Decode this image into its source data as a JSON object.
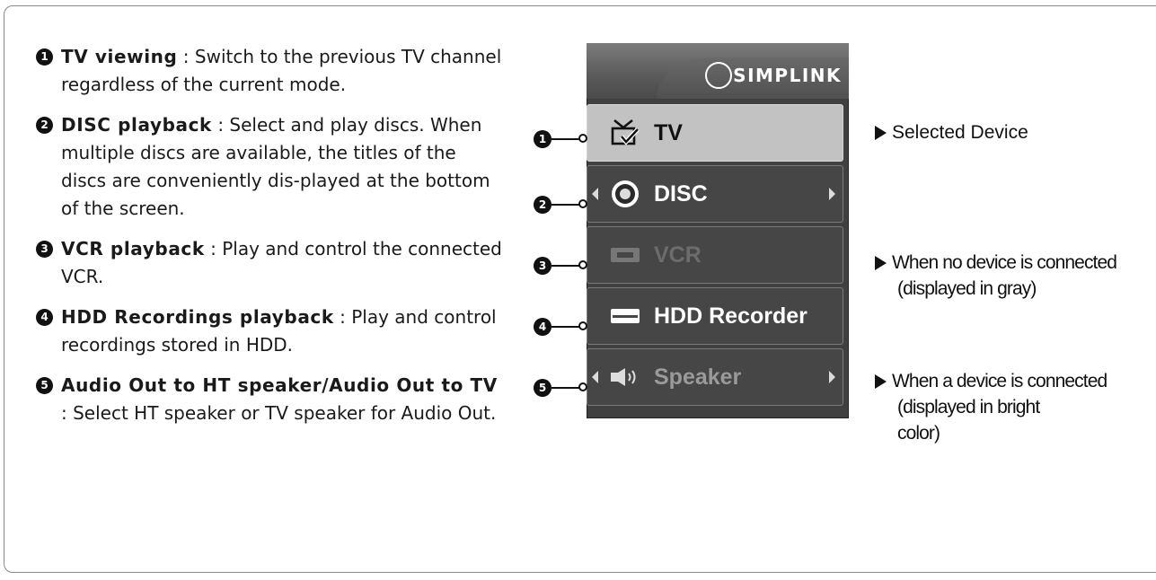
{
  "features": [
    {
      "num": "1",
      "title": "TV viewing",
      "desc": ": Switch to the previous TV channel regardless of the current mode."
    },
    {
      "num": "2",
      "title": "DISC playback",
      "desc": ": Select and play discs. When multiple discs are available, the titles of the discs are conveniently dis-played at the bottom of the screen."
    },
    {
      "num": "3",
      "title": "VCR playback",
      "desc": ": Play and control the connected VCR."
    },
    {
      "num": "4",
      "title": "HDD Recordings playback",
      "desc": ": Play and control recordings stored in HDD."
    },
    {
      "num": "5",
      "title": "Audio Out to HT speaker/Audio Out to TV",
      "desc": ": Select HT speaker or TV speaker for Audio Out."
    }
  ],
  "menu": {
    "logo": "SIMPLINK",
    "items": [
      {
        "label": "TV",
        "icon": "tv-check-icon",
        "state": "selected"
      },
      {
        "label": "DISC",
        "icon": "disc-icon",
        "state": "connected"
      },
      {
        "label": "VCR",
        "icon": "vcr-icon",
        "state": "disconnected"
      },
      {
        "label": "HDD Recorder",
        "icon": "hdd-recorder-icon",
        "state": "connected"
      },
      {
        "label": "Speaker",
        "icon": "speaker-icon",
        "state": "connected"
      }
    ]
  },
  "markers": [
    "1",
    "2",
    "3",
    "4",
    "5"
  ],
  "notes": [
    {
      "line1": "Selected Device",
      "line2": ""
    },
    {
      "line1": "When no device is connected",
      "line2": "(displayed in gray)"
    },
    {
      "line1": "When a device is connected",
      "line2": "(displayed in bright color)"
    }
  ],
  "colors": {
    "selected_bg": "#c2c2c2",
    "item_bg": "#464646",
    "disabled_text": "#6c6c6c"
  }
}
